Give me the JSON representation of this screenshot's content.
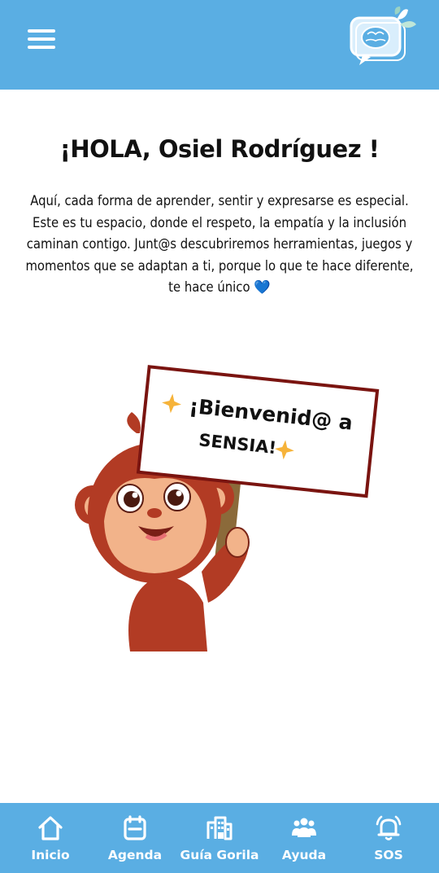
{
  "header": {
    "menu_icon": "hamburger-menu-icon",
    "logo_icon": "brain-chat-logo-icon"
  },
  "main": {
    "greeting": "¡HOLA, Osiel Rodríguez !",
    "intro_text": "Aquí, cada forma de aprender, sentir y expresarse es especial. Este es tu espacio, donde el respeto, la empatía y la inclusión caminan contigo. Junt@s descubriremos herramientas, juegos y momentos que se adaptan a ti, porque lo que te hace diferente, te hace único",
    "intro_heart": "💙",
    "sign_line1": "¡Bienvenid@ a",
    "sign_line2": "SENSIA!"
  },
  "bottom_nav": {
    "items": [
      {
        "label": "Inicio",
        "icon": "home-icon"
      },
      {
        "label": "Agenda",
        "icon": "calendar-icon"
      },
      {
        "label": "Guía Gorila",
        "icon": "building-icon"
      },
      {
        "label": "Ayuda",
        "icon": "people-icon"
      },
      {
        "label": "SOS",
        "icon": "alarm-bell-icon"
      }
    ]
  },
  "colors": {
    "primary": "#5aaee3",
    "text": "#111111",
    "heart": "#2d7bd6"
  }
}
